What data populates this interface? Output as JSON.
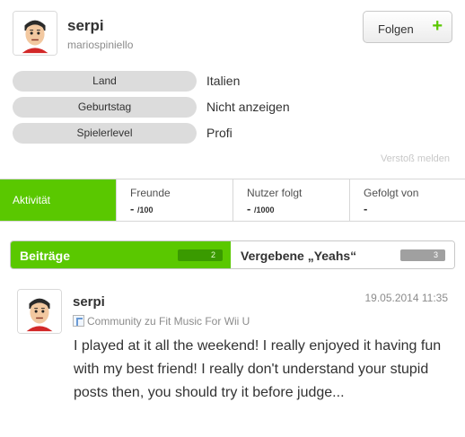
{
  "profile": {
    "name": "serpi",
    "handle": "mariospiniello",
    "follow_label": "Folgen",
    "follow_icon": "+"
  },
  "info": [
    {
      "label": "Land",
      "value": "Italien"
    },
    {
      "label": "Geburtstag",
      "value": "Nicht anzeigen"
    },
    {
      "label": "Spielerlevel",
      "value": "Profi"
    }
  ],
  "report_label": "Verstoß melden",
  "stats": {
    "activity_label": "Aktivität",
    "friends": {
      "label": "Freunde",
      "value": "-",
      "max": "/100"
    },
    "following": {
      "label": "Nutzer folgt",
      "value": "-",
      "max": "/1000"
    },
    "followers": {
      "label": "Gefolgt von",
      "value": "-"
    }
  },
  "tabs": {
    "posts": {
      "label": "Beiträge",
      "count": "2"
    },
    "yeahs": {
      "label": "Vergebene „Yeahs“",
      "count": "3"
    }
  },
  "post": {
    "author": "serpi",
    "date": "19.05.2014 11:35",
    "community": "Community zu Fit Music For Wii U",
    "body": "I played at it all the weekend! I really enjoyed it having fun with my best friend! I really don't understand your stupid posts then, you should try it before judge..."
  },
  "colors": {
    "accent_green": "#5ac800",
    "pill_gray": "#dcdcdc"
  }
}
